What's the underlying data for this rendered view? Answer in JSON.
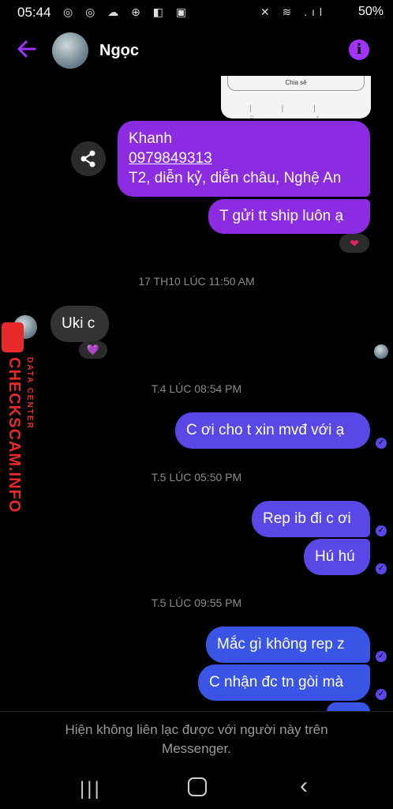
{
  "status_bar": {
    "time": "05:44",
    "left_icons": "◎ ◎ ☁ ⊕ ◧ ▣",
    "right_icons": "✕ ≋ .ıl",
    "battery": "50%"
  },
  "header": {
    "contact_name": "Ngọc",
    "info_label": "i"
  },
  "preview": {
    "button_label": "Chia sẻ",
    "nav": "||| ○ ‹"
  },
  "messages": {
    "m1_line1": "Khanh",
    "m1_phone": "0979849313",
    "m1_line3": "T2, diễn kỷ, diễn châu, Nghệ An",
    "m2": "T gửi tt ship luôn ạ",
    "reaction1": "❤",
    "timestamp1": "17 TH10 LÚC 11:50 AM",
    "m3": "Uki c",
    "reaction2": "💜",
    "timestamp2": "T.4 LÚC 08:54 PM",
    "m4": "C ơi cho t xin mvđ với ạ",
    "timestamp3": "T.5 LÚC 05:50 PM",
    "m5": "Rep ib đi c ơi",
    "m6": "Hú hú",
    "timestamp4": "T.5 LÚC 09:55 PM",
    "m7": "Mắc gì không rep z",
    "m8": "C nhận đc tn gòi mà",
    "check": "✓"
  },
  "footer": {
    "notice": "Hiện không liên lạc được với người này trên Messenger."
  },
  "navbar": {
    "recent": "|||",
    "back": "‹"
  },
  "watermark": {
    "main": "CHECKSCAM.INFO",
    "sub": "DATA CENTER"
  },
  "colors": {
    "purple": "#8b2be2",
    "blue": "#3a55e6",
    "accent": "#a033ff"
  }
}
